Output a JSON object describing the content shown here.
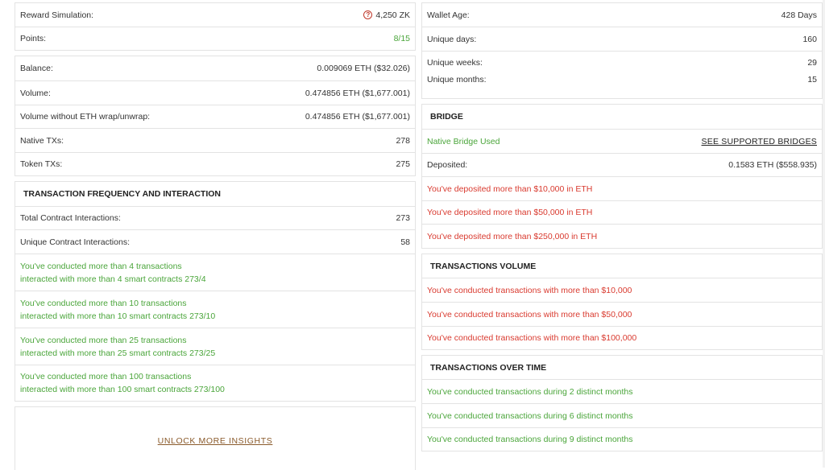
{
  "summary": {
    "reward_label": "Reward Simulation:",
    "reward_value": "4,250 ZK",
    "points_label": "Points:",
    "points_value": "8/15"
  },
  "balances": [
    {
      "label": "Balance:",
      "value": "0.009069 ETH ($32.026)"
    },
    {
      "label": "Volume:",
      "value": "0.474856 ETH ($1,677.001)"
    },
    {
      "label": "Volume without ETH wrap/unwrap:",
      "value": "0.474856 ETH ($1,677.001)"
    },
    {
      "label": "Native TXs:",
      "value": "278"
    },
    {
      "label": "Token TXs:",
      "value": "275"
    }
  ],
  "tx_frequency": {
    "title": "TRANSACTION FREQUENCY AND INTERACTION",
    "total_label": "Total Contract Interactions:",
    "total_value": "273",
    "unique_label": "Unique Contract Interactions:",
    "unique_value": "58",
    "milestones": [
      {
        "line1": "You've conducted more than 4 transactions",
        "line2": "interacted with more than 4 smart contracts 273/4"
      },
      {
        "line1": "You've conducted more than 10 transactions",
        "line2": "interacted with more than 10 smart contracts 273/10"
      },
      {
        "line1": "You've conducted more than 25 transactions",
        "line2": "interacted with more than 25 smart contracts 273/25"
      },
      {
        "line1": "You've conducted more than 100 transactions",
        "line2": "interacted with more than 100 smart contracts 273/100"
      }
    ]
  },
  "unlock_label": "UNLOCK MORE INSIGHTS",
  "wallet_age": {
    "age_label": "Wallet Age:",
    "age_value": "428 Days",
    "days_label": "Unique days:",
    "days_value": "160",
    "weeks_label": "Unique weeks:",
    "weeks_value": "29",
    "months_label": "Unique months:",
    "months_value": "15"
  },
  "bridge": {
    "title": "BRIDGE",
    "native_label": "Native Bridge Used",
    "supported_link": "SEE SUPPORTED BRIDGES",
    "deposited_label": "Deposited:",
    "deposited_value": "0.1583 ETH ($558.935)",
    "milestones": [
      "You've deposited more than $10,000 in ETH",
      "You've deposited more than $50,000 in ETH",
      "You've deposited more than $250,000 in ETH"
    ]
  },
  "tx_volume": {
    "title": "TRANSACTIONS VOLUME",
    "milestones": [
      "You've conducted transactions with more than $10,000",
      "You've conducted transactions with more than $50,000",
      "You've conducted transactions with more than $100,000"
    ]
  },
  "tx_time": {
    "title": "TRANSACTIONS OVER TIME",
    "milestones": [
      "You've conducted transactions during 2 distinct months",
      "You've conducted transactions during 6 distinct months",
      "You've conducted transactions during 9 distinct months"
    ]
  },
  "colors": {
    "success": "#4aa53a",
    "fail": "#d93a2f",
    "border": "#e3e3e3"
  },
  "icons": {
    "reward_info": "question-circle-icon"
  }
}
